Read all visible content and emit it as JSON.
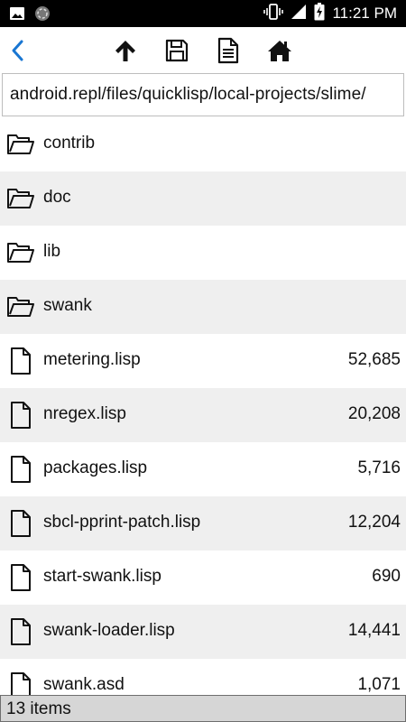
{
  "status_bar": {
    "time": "11:21 PM",
    "left_icons": [
      "image-icon",
      "sync-icon"
    ],
    "right_icons": [
      "vibrate-icon",
      "signal-icon",
      "battery-charging-icon"
    ]
  },
  "toolbar": {
    "back_icon": "chevron-left-icon",
    "up_icon": "arrow-up-icon",
    "save_icon": "floppy-disk-icon",
    "document_icon": "document-icon",
    "home_icon": "home-icon",
    "accent_color": "#1976d2"
  },
  "path": {
    "value": "android.repl/files/quicklisp/local-projects/slime/"
  },
  "files": [
    {
      "name": "contrib",
      "type": "folder",
      "size": ""
    },
    {
      "name": "doc",
      "type": "folder",
      "size": ""
    },
    {
      "name": "lib",
      "type": "folder",
      "size": ""
    },
    {
      "name": "swank",
      "type": "folder",
      "size": ""
    },
    {
      "name": "metering.lisp",
      "type": "file",
      "size": "52,685"
    },
    {
      "name": "nregex.lisp",
      "type": "file",
      "size": "20,208"
    },
    {
      "name": "packages.lisp",
      "type": "file",
      "size": "5,716"
    },
    {
      "name": "sbcl-pprint-patch.lisp",
      "type": "file",
      "size": "12,204"
    },
    {
      "name": "start-swank.lisp",
      "type": "file",
      "size": "690"
    },
    {
      "name": "swank-loader.lisp",
      "type": "file",
      "size": "14,441"
    },
    {
      "name": "swank.asd",
      "type": "file",
      "size": "1,071"
    }
  ],
  "footer": {
    "item_count": "13 items"
  }
}
